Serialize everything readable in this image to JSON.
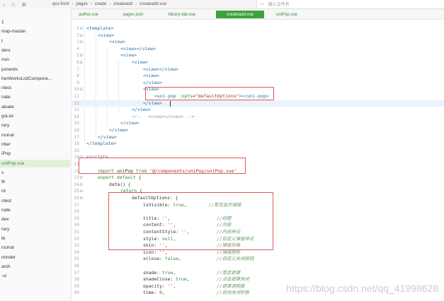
{
  "topbar": {
    "breadcrumb": [
      "qcx-front",
      "pages",
      "create",
      "createadd",
      "createadd.vue"
    ],
    "search_placeholder": "输入文件名"
  },
  "tabs": [
    {
      "label": "author.vue",
      "active": false
    },
    {
      "label": "pages.json",
      "active": false
    },
    {
      "label": "library-tab.vue",
      "active": false
    },
    {
      "label": "createadd.vue",
      "active": true
    },
    {
      "label": "uniPop.vue",
      "active": false
    }
  ],
  "sidebar": {
    "items": [
      {
        "label": "1",
        "selected": false
      },
      {
        "label": "map-master",
        "selected": false
      },
      {
        "label": "t",
        "selected": false
      },
      {
        "label": "derx",
        "selected": false
      },
      {
        "label": "non",
        "selected": false
      },
      {
        "label": "ponents",
        "selected": false
      },
      {
        "label": "herWorksListCompone...",
        "selected": false
      },
      {
        "label": "ntest",
        "selected": false
      },
      {
        "label": "nate",
        "selected": false
      },
      {
        "label": "aluate",
        "selected": false
      },
      {
        "label": "gsList",
        "selected": false
      },
      {
        "label": "rary",
        "selected": false
      },
      {
        "label": "rsonal",
        "selected": false
      },
      {
        "label": "nber",
        "selected": false
      },
      {
        "label": "iPop",
        "selected": false
      },
      {
        "label": "uniPop.vue",
        "selected": true
      },
      {
        "label": "s",
        "selected": false
      },
      {
        "label": "th",
        "selected": false
      },
      {
        "label": "rd",
        "selected": false
      },
      {
        "label": "ntest",
        "selected": false
      },
      {
        "label": "nate",
        "selected": false
      },
      {
        "label": "dex",
        "selected": false
      },
      {
        "label": "rary",
        "selected": false
      },
      {
        "label": "te",
        "selected": false
      },
      {
        "label": "rsonal",
        "selected": false
      },
      {
        "label": "minder",
        "selected": false
      },
      {
        "label": "arch",
        "selected": false
      },
      {
        "label": "-ui",
        "selected": false
      }
    ]
  },
  "code_lines": [
    {
      "n": "1",
      "fold": "⊟",
      "indent": 0,
      "parts": [
        [
          "tg",
          "<template>"
        ]
      ]
    },
    {
      "n": "2",
      "fold": "⊟",
      "indent": 1,
      "parts": [
        [
          "tg",
          "<view>"
        ]
      ]
    },
    {
      "n": "3",
      "fold": "⊟",
      "indent": 2,
      "parts": [
        [
          "tg",
          "<view>"
        ]
      ]
    },
    {
      "n": "4",
      "fold": "",
      "indent": 3,
      "parts": [
        [
          "tg",
          "<view></view>"
        ]
      ]
    },
    {
      "n": "5",
      "fold": "⊟",
      "indent": 3,
      "parts": [
        [
          "tg",
          "<view>"
        ]
      ]
    },
    {
      "n": "6",
      "fold": "⊟",
      "indent": 4,
      "parts": [
        [
          "tg",
          "<view>"
        ]
      ]
    },
    {
      "n": "7",
      "fold": "",
      "indent": 5,
      "parts": [
        [
          "tg",
          "<view></view>"
        ]
      ]
    },
    {
      "n": "8",
      "fold": "",
      "indent": 5,
      "parts": [
        [
          "tg",
          "<view>"
        ]
      ]
    },
    {
      "n": "9",
      "fold": "",
      "indent": 5,
      "parts": [
        [
          "tg",
          "</view>"
        ]
      ]
    },
    {
      "n": "10",
      "fold": "⊟",
      "indent": 5,
      "parts": [
        [
          "tg",
          "<view>"
        ]
      ]
    },
    {
      "n": "11",
      "fold": "",
      "indent": 6,
      "parts": [
        [
          "tg",
          "<uni-pop "
        ],
        [
          "kw",
          ":opts"
        ],
        [
          "pl",
          "="
        ],
        [
          "st",
          "\"defaultOptions\""
        ],
        [
          "tg",
          "></uni-pop>"
        ]
      ]
    },
    {
      "n": "12",
      "fold": "",
      "indent": 5,
      "parts": [
        [
          "tg",
          "</view>"
        ]
      ],
      "hl": true
    },
    {
      "n": "13",
      "fold": "",
      "indent": 4,
      "parts": [
        [
          "tg",
          "</view>"
        ]
      ]
    },
    {
      "n": "14",
      "fold": "",
      "indent": 4,
      "parts": [
        [
          "cm",
          "<!--  <view></view> -->"
        ]
      ]
    },
    {
      "n": "15",
      "fold": "",
      "indent": 3,
      "parts": [
        [
          "tg",
          "</view>"
        ]
      ]
    },
    {
      "n": "16",
      "fold": "",
      "indent": 2,
      "parts": [
        [
          "tg",
          "</view>"
        ]
      ]
    },
    {
      "n": "17",
      "fold": "",
      "indent": 1,
      "parts": [
        [
          "tg",
          "</view>"
        ]
      ]
    },
    {
      "n": "18",
      "fold": "",
      "indent": 0,
      "parts": [
        [
          "tg",
          "</template>"
        ]
      ]
    },
    {
      "n": "19",
      "fold": "",
      "indent": 0,
      "parts": []
    },
    {
      "n": "20",
      "fold": "⊟",
      "indent": 0,
      "parts": [
        [
          "tg",
          "<script>"
        ]
      ]
    },
    {
      "n": "21",
      "fold": "",
      "indent": 0,
      "parts": []
    },
    {
      "n": "22",
      "fold": "",
      "indent": 1,
      "parts": [
        [
          "kw",
          "import"
        ],
        [
          "pl",
          " uniPop "
        ],
        [
          "kw",
          "from"
        ],
        [
          "st",
          " '@/components/uniPop/uniPop.vue'"
        ]
      ]
    },
    {
      "n": "23",
      "fold": "⊟",
      "indent": 1,
      "parts": [
        [
          "kw",
          "export default"
        ],
        [
          "pl",
          " {"
        ]
      ]
    },
    {
      "n": "24",
      "fold": "⊟",
      "indent": 2,
      "parts": [
        [
          "pl",
          "data() {"
        ]
      ]
    },
    {
      "n": "25",
      "fold": "⊟",
      "indent": 3,
      "parts": [
        [
          "kw",
          "return"
        ],
        [
          "pl",
          " {"
        ]
      ]
    },
    {
      "n": "26",
      "fold": "⊟",
      "indent": 4,
      "parts": [
        [
          "pl",
          "defaultOptions: {"
        ]
      ]
    },
    {
      "n": "27",
      "fold": "",
      "indent": 5,
      "parts": [
        [
          "pl",
          "isVisible: "
        ],
        [
          "kw",
          "true"
        ],
        [
          "pl",
          ",        "
        ],
        [
          "cm-cn",
          "//是否显示弹窗"
        ]
      ]
    },
    {
      "n": "28",
      "fold": "",
      "indent": 5,
      "parts": []
    },
    {
      "n": "29",
      "fold": "",
      "indent": 5,
      "parts": [
        [
          "pl",
          "title: "
        ],
        [
          "st",
          "''"
        ],
        [
          "pl",
          ",                 "
        ],
        [
          "cm-cn",
          "//标题"
        ]
      ]
    },
    {
      "n": "30",
      "fold": "",
      "indent": 5,
      "parts": [
        [
          "pl",
          "content: "
        ],
        [
          "st",
          "''"
        ],
        [
          "pl",
          ",               "
        ],
        [
          "cm-cn",
          "//内容"
        ]
      ]
    },
    {
      "n": "31",
      "fold": "",
      "indent": 5,
      "parts": [
        [
          "pl",
          "contentStyle: "
        ],
        [
          "st",
          "''"
        ],
        [
          "pl",
          ",          "
        ],
        [
          "cm-cn",
          "//内容样式"
        ]
      ]
    },
    {
      "n": "32",
      "fold": "",
      "indent": 5,
      "parts": [
        [
          "pl",
          "style: "
        ],
        [
          "kw",
          "null"
        ],
        [
          "pl",
          ",               "
        ],
        [
          "cm-cn",
          "//自定义弹窗样式"
        ]
      ]
    },
    {
      "n": "33",
      "fold": "",
      "indent": 5,
      "parts": [
        [
          "pl",
          "skin: "
        ],
        [
          "st",
          "''"
        ],
        [
          "pl",
          ",                  "
        ],
        [
          "cm-cn",
          "//弹窗风格"
        ]
      ]
    },
    {
      "n": "34",
      "fold": "",
      "indent": 5,
      "parts": [
        [
          "pl",
          "icon: "
        ],
        [
          "st",
          "''"
        ],
        [
          "pl",
          ",                  "
        ],
        [
          "cm-cn",
          "//弹窗图标"
        ]
      ]
    },
    {
      "n": "35",
      "fold": "",
      "indent": 5,
      "parts": [
        [
          "pl",
          "xclose: "
        ],
        [
          "kw",
          "false"
        ],
        [
          "pl",
          ",             "
        ],
        [
          "cm-cn",
          "//自定义关闭按钮"
        ]
      ]
    },
    {
      "n": "36",
      "fold": "",
      "indent": 5,
      "parts": []
    },
    {
      "n": "37",
      "fold": "",
      "indent": 5,
      "parts": [
        [
          "pl",
          "shade: "
        ],
        [
          "kw",
          "true"
        ],
        [
          "pl",
          ",               "
        ],
        [
          "cm-cn",
          "//是否遮罩"
        ]
      ]
    },
    {
      "n": "38",
      "fold": "",
      "indent": 5,
      "parts": [
        [
          "pl",
          "shadeClose: "
        ],
        [
          "kw",
          "true"
        ],
        [
          "pl",
          ",          "
        ],
        [
          "cm-cn",
          "//点击遮罩关闭"
        ]
      ]
    },
    {
      "n": "39",
      "fold": "",
      "indent": 5,
      "parts": [
        [
          "pl",
          "opacity: "
        ],
        [
          "st",
          "''"
        ],
        [
          "pl",
          ",               "
        ],
        [
          "cm-cn",
          "//遮罩透明度"
        ]
      ]
    },
    {
      "n": "40",
      "fold": "",
      "indent": 5,
      "parts": [
        [
          "pl",
          "time: "
        ],
        [
          "kw",
          "0"
        ],
        [
          "pl",
          ",                   "
        ],
        [
          "cm-cn",
          "//自动关闭秒数"
        ]
      ]
    }
  ],
  "watermark": "https://blog.csdn.net/qq_41998628"
}
